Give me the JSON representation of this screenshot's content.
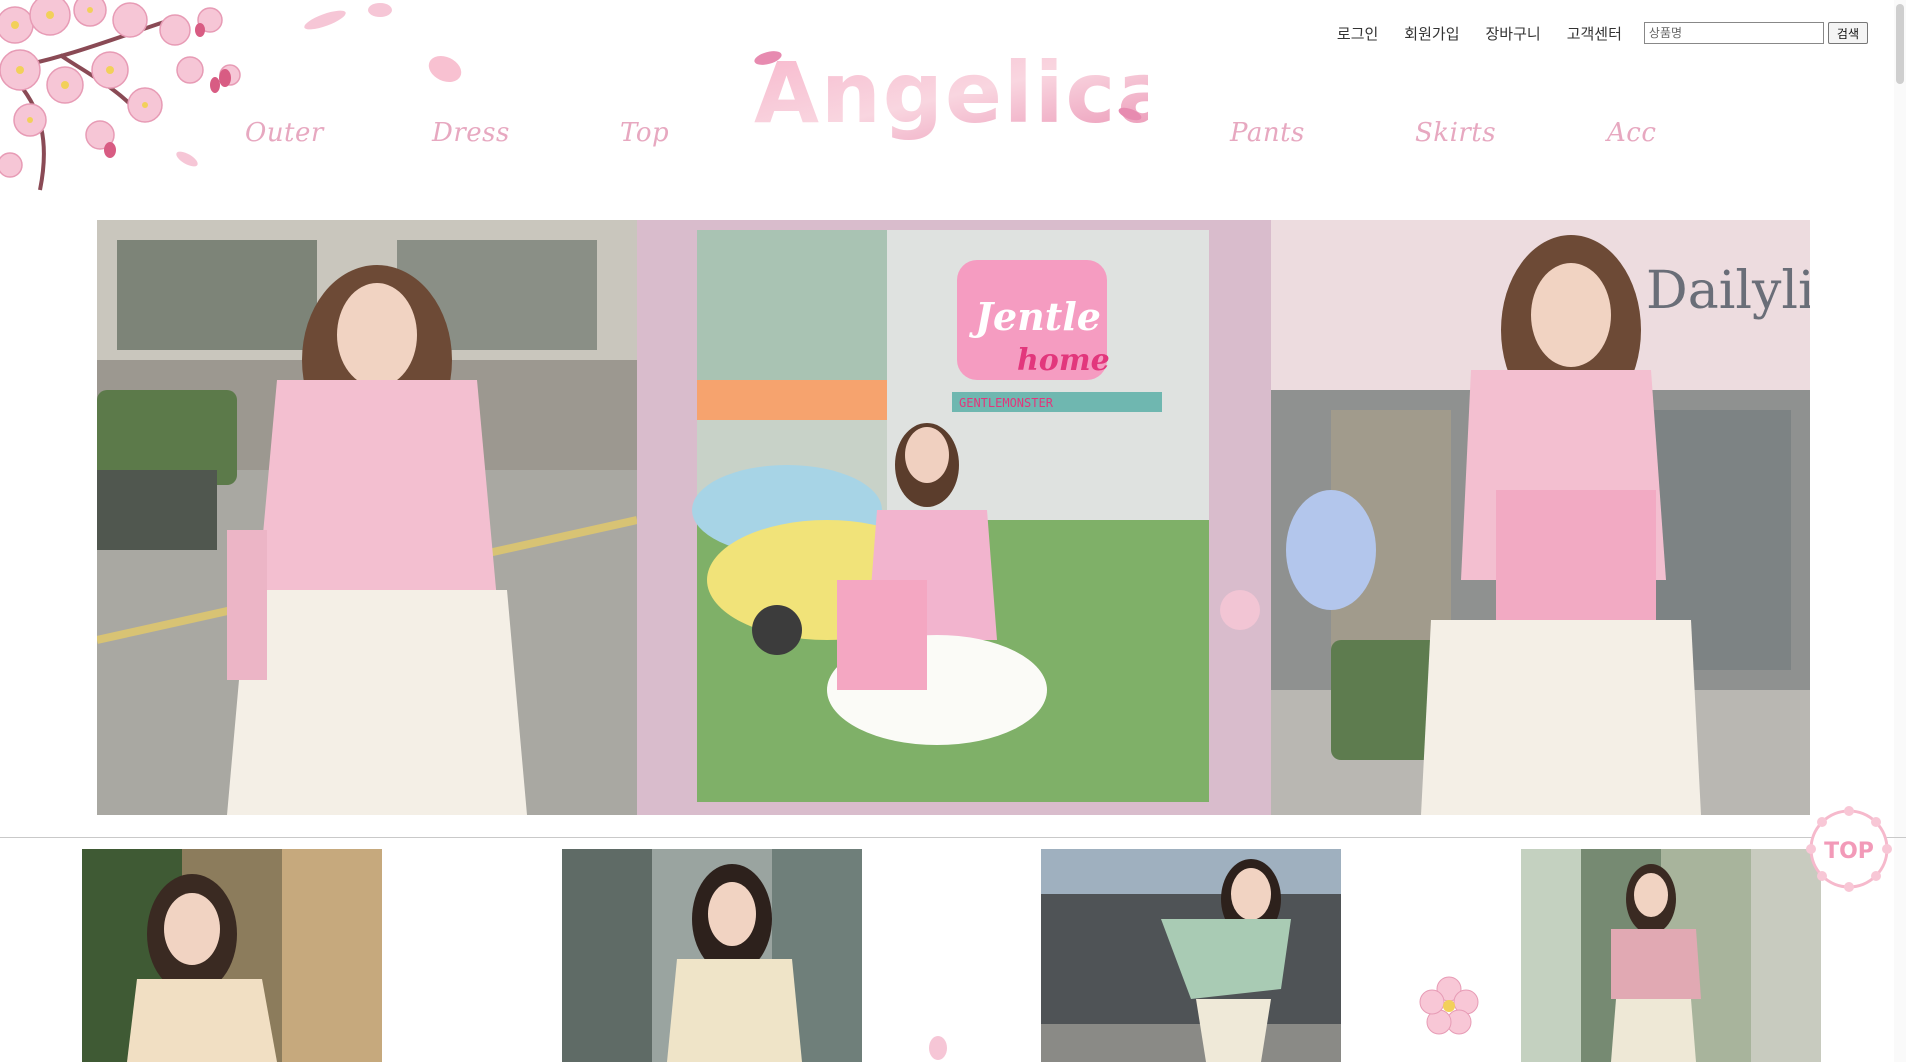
{
  "header": {
    "logo_text": "Angelica",
    "util_links": [
      "로그인",
      "회원가입",
      "장바구니",
      "고객센터"
    ],
    "search": {
      "placeholder": "상품명",
      "button_label": "검색"
    }
  },
  "nav": {
    "left": [
      "Outer",
      "Dress",
      "Top"
    ],
    "right": [
      "Pants",
      "Skirts",
      "Acc"
    ]
  },
  "hero": {
    "left": {
      "signage": ""
    },
    "center": {
      "sign_main": "Jentle",
      "sign_sub": "home",
      "sign_strip": "GENTLEMONSTER"
    },
    "right": {
      "store_sign": "Dailyli"
    }
  },
  "top_button": {
    "label": "TOP"
  },
  "colors": {
    "accent_pink": "#e7a8c0",
    "logo_pink": "#f0a7c3",
    "hero_mauve": "#d9bccc",
    "petal_pink": "#f6c6d6"
  }
}
